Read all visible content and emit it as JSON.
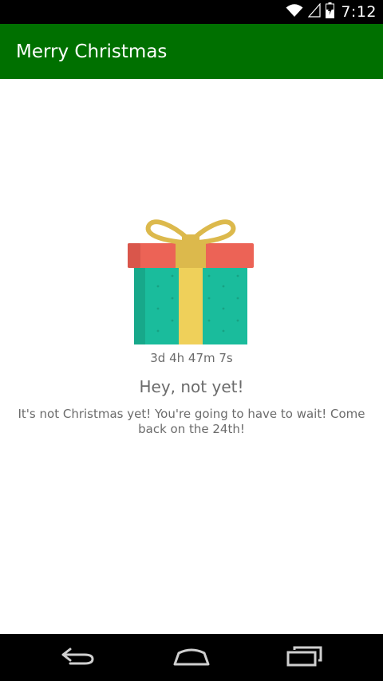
{
  "status_bar": {
    "time": "7:12",
    "icons": [
      "wifi-icon",
      "signal-icon",
      "battery-icon"
    ]
  },
  "app_bar": {
    "title": "Merry Christmas",
    "color": "#007000"
  },
  "main": {
    "illustration": "gift-icon",
    "countdown": "3d 4h 47m 7s",
    "headline": "Hey, not yet!",
    "message": "It's not Christmas yet! You're going to have to wait! Come back on the 24th!"
  },
  "nav_bar": {
    "buttons": [
      "back-icon",
      "home-icon",
      "recent-apps-icon"
    ]
  },
  "colors": {
    "gift_box": "#1abc9c",
    "gift_lid": "#ec6356",
    "ribbon": "#efd05a",
    "bow": "#dcb94c"
  }
}
